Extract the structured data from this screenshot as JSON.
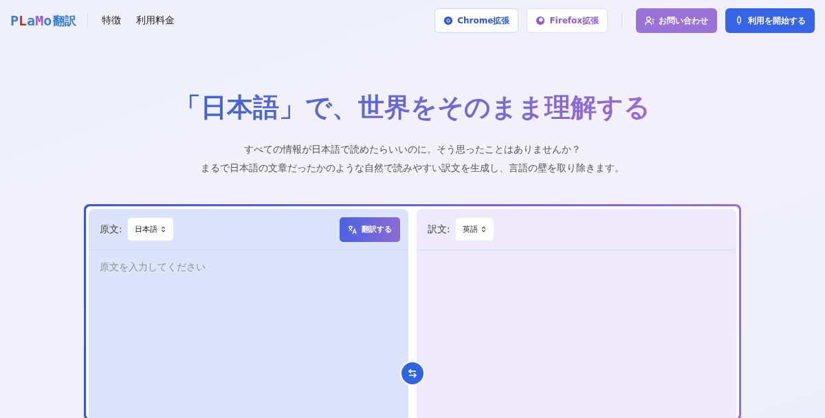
{
  "header": {
    "logo": {
      "letters": [
        {
          "text": "P",
          "color": "#3b82d6"
        },
        {
          "text": "L",
          "color": "#d42a2a"
        },
        {
          "text": "a",
          "color": "#3b82d6"
        },
        {
          "text": "M",
          "color": "#9b59d0"
        },
        {
          "text": "o",
          "color": "#3b82d6"
        }
      ],
      "suffix": "翻訳"
    },
    "nav": [
      "特徴",
      "利用料金"
    ],
    "buttons": [
      {
        "kind": "chrome",
        "label": "Chrome拡張"
      },
      {
        "kind": "firefox",
        "label": "Firefox拡張"
      },
      {
        "kind": "contact",
        "label": "お問い合わせ"
      },
      {
        "kind": "start",
        "label": "利用を開始する"
      }
    ]
  },
  "hero": {
    "title": "「日本語」で、世界をそのまま理解する",
    "lines": [
      "すべての情報が日本語で読めたらいいのに。そう思ったことはありませんか？",
      "まるで日本語の文章だったかのような自然で読みやすい訳文を生成し、言語の壁を取り除きます。"
    ]
  },
  "translator": {
    "source": {
      "label": "原文:",
      "language": "日本語",
      "translate_button": "翻訳する",
      "placeholder": "原文を入力してください"
    },
    "target": {
      "label": "訳文:",
      "language": "英語"
    }
  }
}
